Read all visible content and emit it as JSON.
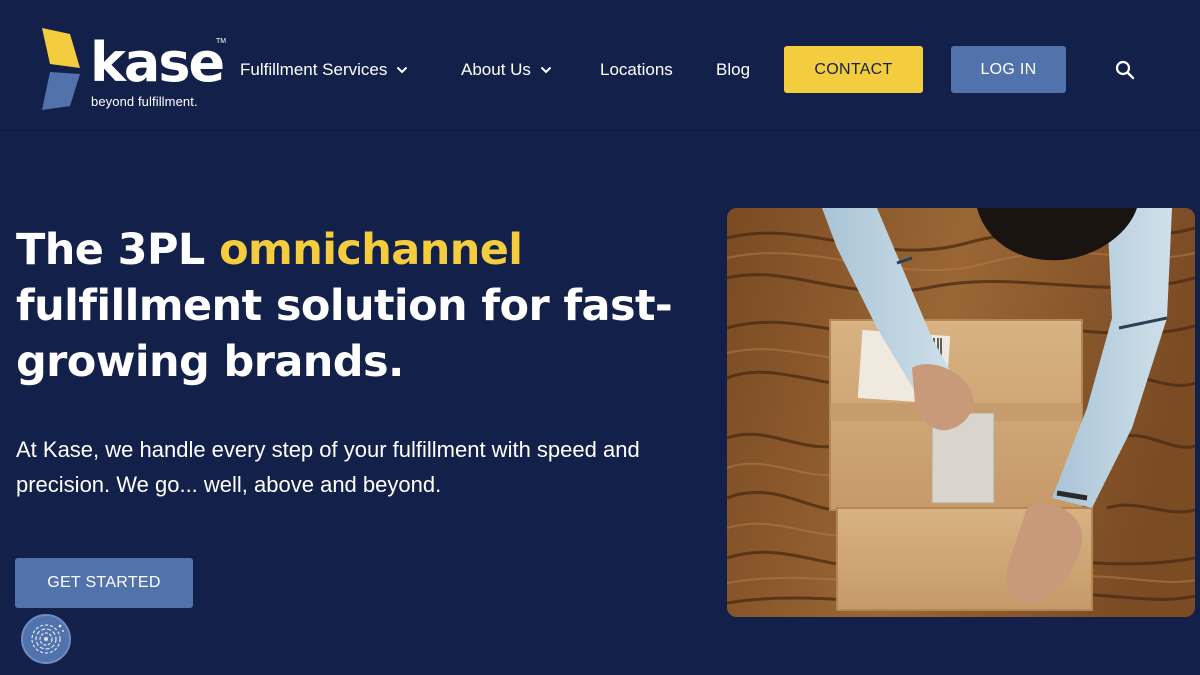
{
  "header": {
    "logo": {
      "wordmark": "kase",
      "trademark": "TM",
      "tagline": "beyond fulfillment.",
      "colors": {
        "mark_yellow": "#f4cd3e",
        "mark_blue": "#5272ac"
      }
    },
    "nav": [
      {
        "label": "Fulfillment Services",
        "has_dropdown": true,
        "icon": "chevron-down-icon"
      },
      {
        "label": "About Us",
        "has_dropdown": true,
        "icon": "chevron-down-icon"
      },
      {
        "label": "Locations",
        "has_dropdown": false
      },
      {
        "label": "Blog",
        "has_dropdown": false
      }
    ],
    "contact_label": "CONTACT",
    "login_label": "LOG IN",
    "search_icon": "search-icon"
  },
  "hero": {
    "title_part1": "The 3PL ",
    "title_accent": "omnichannel",
    "title_part2": " fulfillment solution for fast-growing brands.",
    "subtitle": "At Kase, we handle every step of your fulfillment with speed and precision. We go... well, above and beyond.",
    "cta_label": "GET STARTED",
    "image_icon": "packing-box-photo"
  },
  "accessibility_badge": {
    "icon": "fingerprint-icon"
  },
  "colors": {
    "background": "#13214a",
    "accent_yellow": "#f4cd3e",
    "button_blue": "#5272ac",
    "text": "#ffffff"
  }
}
